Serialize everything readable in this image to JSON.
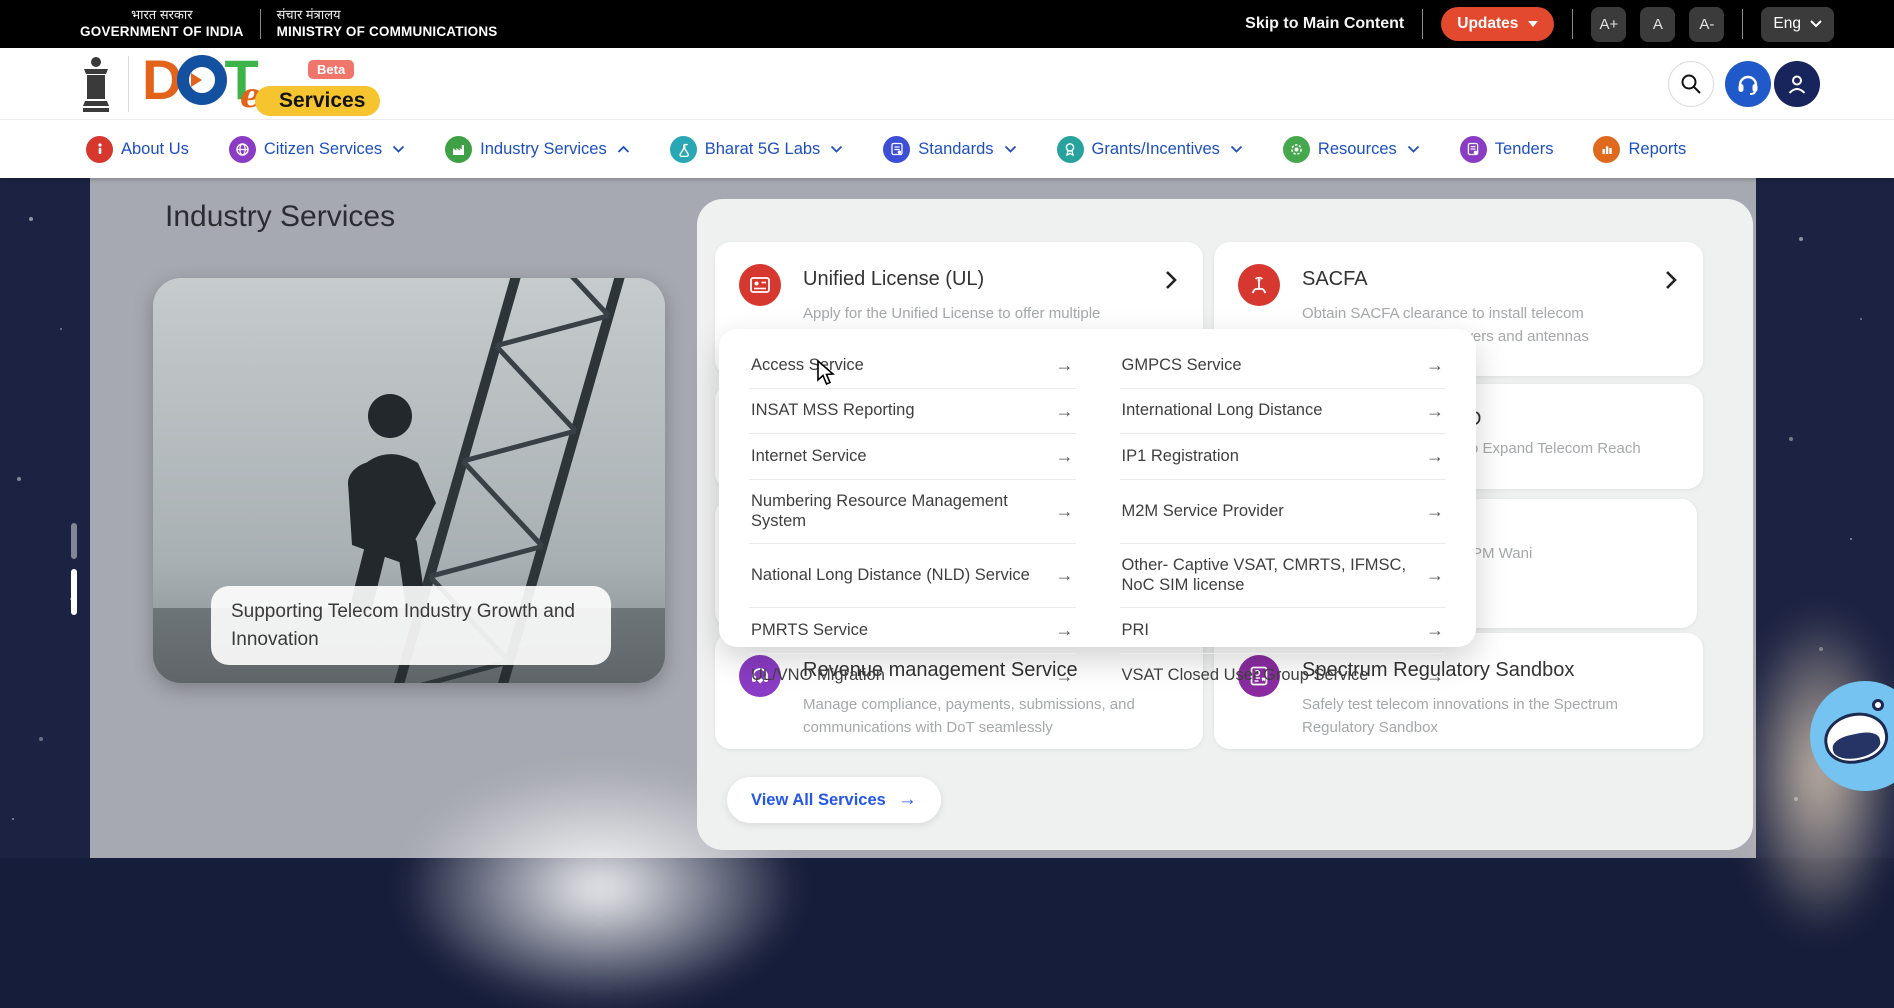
{
  "topbar": {
    "gov_hi": "भारत सरकार",
    "gov_en": "GOVERNMENT OF INDIA",
    "ministry_hi": "संचार मंत्रालय",
    "ministry_en": "MINISTRY OF COMMUNICATIONS",
    "skip_link": "Skip to Main Content",
    "updates_label": "Updates",
    "font_increase": "A+",
    "font_reset": "A",
    "font_decrease": "A-",
    "language": "Eng"
  },
  "header": {
    "logo_d": "D",
    "logo_t": "T",
    "beta": "Beta",
    "e": "e",
    "services": "Services"
  },
  "nav": {
    "items": [
      {
        "label": "About Us"
      },
      {
        "label": "Citizen Services"
      },
      {
        "label": "Industry Services"
      },
      {
        "label": "Bharat 5G Labs"
      },
      {
        "label": "Standards"
      },
      {
        "label": "Grants/Incentives"
      },
      {
        "label": "Resources"
      },
      {
        "label": "Tenders"
      },
      {
        "label": "Reports"
      }
    ]
  },
  "hero": {
    "title": "Industry Services",
    "caption": "Supporting Telecom Industry Growth and Innovation"
  },
  "services": {
    "unified_license": {
      "title": "Unified License (UL)",
      "desc": "Apply for the Unified License to offer multiple telecom services under one authorization"
    },
    "sacfa": {
      "title": "SACFA",
      "desc": "Obtain SACFA clearance to install telecom infrastructure such as towers and antennas"
    },
    "partial_row2": {
      "title_fragment": "D",
      "desc_fragment": "o Expand Telecom Reach"
    },
    "partial_row3": {
      "desc_fragment": "PM Wani"
    },
    "revenue": {
      "title": "Revenue management Service",
      "desc": "Manage compliance, payments, submissions, and communications with DoT seamlessly"
    },
    "sandbox": {
      "title": "Spectrum Regulatory Sandbox",
      "desc": "Safely test telecom innovations in the Spectrum Regulatory Sandbox"
    },
    "view_all": "View All Services"
  },
  "dropdown": {
    "left": [
      "Access Service",
      "INSAT MSS Reporting",
      "Internet Service",
      "Numbering Resource Management System",
      "National Long Distance (NLD) Service",
      "PMRTS Service",
      "UL/VNO Migration"
    ],
    "right": [
      "GMPCS Service",
      "International Long Distance",
      "IP1 Registration",
      "M2M Service Provider",
      "Other- Captive VSAT, CMRTS, IFMSC, NoC SIM license",
      "PRI",
      "VSAT Closed User Group Service"
    ]
  },
  "colors": {
    "updates_red": "#e2492f",
    "nav_blue": "#1e4fc2",
    "brand_orange": "#e2631c",
    "brand_green": "#3cb44a",
    "brand_blue": "#1450a0",
    "brand_yellow": "#f6c42e",
    "icon_red": "#d6372e",
    "icon_purple": "#8a3cc4",
    "link_blue": "#2457e6"
  }
}
